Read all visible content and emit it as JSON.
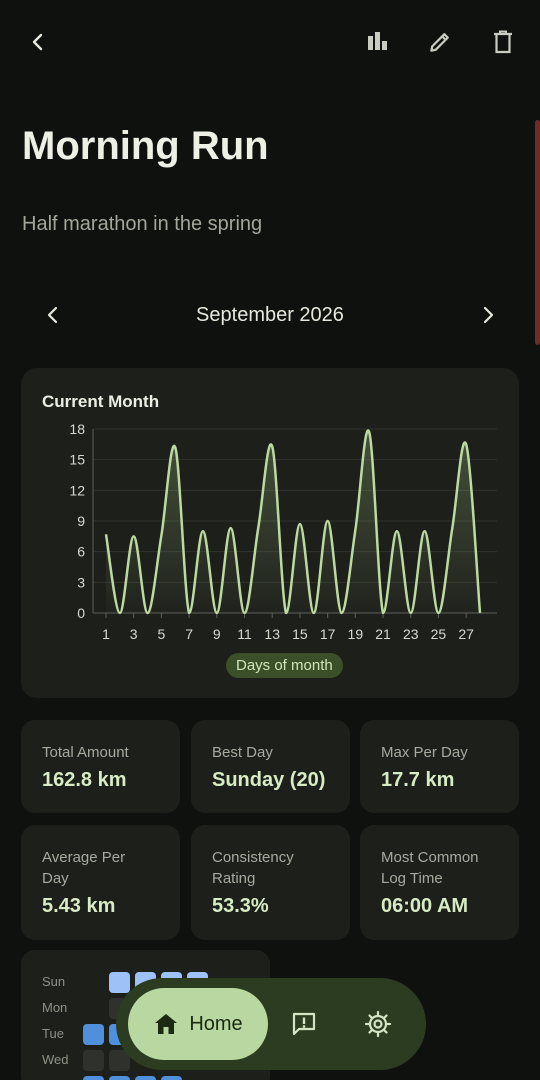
{
  "header": {
    "back_icon": "back-arrow-icon",
    "stats_icon": "bar-chart-icon",
    "edit_icon": "pencil-icon",
    "delete_icon": "trash-icon"
  },
  "habit": {
    "title": "Morning Run",
    "description": "Half marathon in the spring"
  },
  "month_nav": {
    "label": "September 2026"
  },
  "chart_card": {
    "title": "Current Month",
    "xlabel": "Days of month"
  },
  "chart_data": {
    "type": "area",
    "title": "Current Month",
    "xlabel": "Days of month",
    "ylabel": "",
    "x": [
      1,
      2,
      3,
      4,
      5,
      6,
      7,
      8,
      9,
      10,
      11,
      12,
      13,
      14,
      15,
      16,
      17,
      18,
      19,
      20,
      21,
      22,
      23,
      24,
      25,
      26,
      27,
      28
    ],
    "values": [
      7.7,
      0,
      7.5,
      0,
      7.6,
      16.2,
      0,
      8.0,
      0,
      8.3,
      0,
      8.4,
      16.3,
      0,
      8.7,
      0,
      9.0,
      0,
      8.1,
      17.7,
      0,
      8.0,
      0,
      8.0,
      0,
      8.3,
      16.5,
      0
    ],
    "x_ticks": [
      1,
      3,
      5,
      7,
      9,
      11,
      13,
      15,
      17,
      19,
      21,
      23,
      25,
      27
    ],
    "y_ticks": [
      0,
      3,
      6,
      9,
      12,
      15,
      18
    ],
    "ylim": [
      0,
      18
    ],
    "xlim": [
      1,
      28
    ],
    "grid": true,
    "line_color": "#bcd9a0"
  },
  "stats": [
    {
      "label": "Total Amount",
      "value": "162.8 km"
    },
    {
      "label": "Best Day",
      "value": "Sunday (20)"
    },
    {
      "label": "Max Per Day",
      "value": "17.7 km"
    },
    {
      "label": "Average Per Day",
      "value": "5.43 km"
    },
    {
      "label": "Consistency Rating",
      "value": "53.3%"
    },
    {
      "label": "Most Common Log Time",
      "value": "06:00 AM"
    }
  ],
  "heatmap": {
    "days": [
      "Sun",
      "Mon",
      "Tue",
      "Wed"
    ]
  },
  "nav": {
    "home_label": "Home",
    "home_icon": "home-icon",
    "feedback_icon": "feedback-icon",
    "settings_icon": "gear-icon"
  },
  "colors": {
    "accent": "#b9d7a0",
    "heat_light": "#9ec1f7",
    "heat_mid": "#4f8fdc",
    "heat_empty": "#2f312d"
  }
}
